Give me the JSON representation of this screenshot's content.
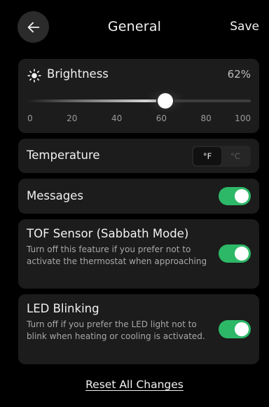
{
  "header": {
    "back_icon": "arrow-left-icon",
    "title": "General",
    "save_label": "Save"
  },
  "brightness": {
    "icon": "sun-icon",
    "label": "Brightness",
    "value_text": "62%",
    "value": 62,
    "min": 0,
    "max": 100,
    "ticks": [
      "0",
      "20",
      "40",
      "60",
      "80",
      "100"
    ]
  },
  "temperature": {
    "label": "Temperature",
    "units": [
      "°F",
      "°C"
    ],
    "selected": "°F"
  },
  "messages": {
    "label": "Messages",
    "enabled": true
  },
  "tof": {
    "title": "TOF Sensor (Sabbath Mode)",
    "description": "Turn off this feature if you prefer not to activate the thermostat when approaching",
    "enabled": true
  },
  "led": {
    "title": "LED Blinking",
    "description": "Turn off if you prefer the LED light not to blink when heating or cooling is activated.",
    "enabled": true
  },
  "reset_label": "Reset All Changes",
  "colors": {
    "background": "#000000",
    "card": "#1c1c1c",
    "toggle_on": "#2db868"
  }
}
